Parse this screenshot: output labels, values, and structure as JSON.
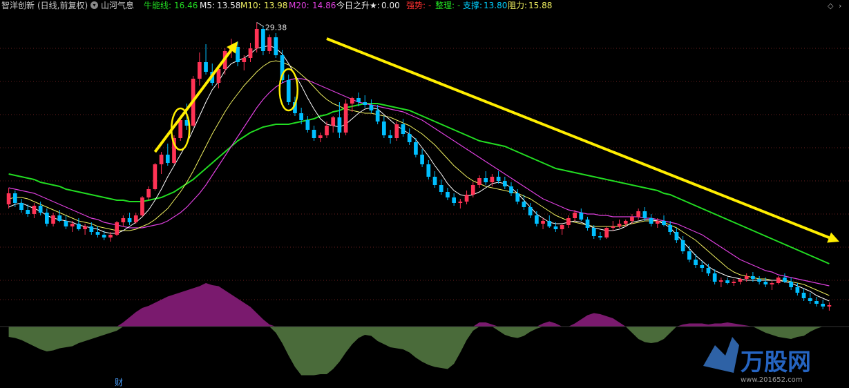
{
  "header": {
    "stock_name": "智洋创新",
    "period": "(日线,前复权)",
    "indicator_name": "山河气息",
    "niuneng_label": "牛能线:",
    "niuneng_value": "16.46",
    "m5_label": "M5:",
    "m5_value": "13.58",
    "m10_label": "M10:",
    "m10_value": "13.98",
    "m20_label": "M20:",
    "m20_value": "14.86",
    "jinri_label": "今日之升★:",
    "jinri_value": "0.00",
    "qiangshi_label": "强势:",
    "qiangshi_value": "-",
    "zhengli_label": "整理:",
    "zhengli_value": "-",
    "zhicheng_label": "支撑:",
    "zhicheng_value": "13.80",
    "zuli_label": "阻力:",
    "zuli_value": "15.88"
  },
  "chart_data": {
    "type": "candlestick",
    "high_marker": "29.38",
    "bottom_label": "财",
    "watermark": "万股网",
    "watermark_url": "www.201652.com",
    "colors": {
      "up": "#ff3355",
      "down": "#00bfff",
      "ma_short": "#ffffff",
      "ma_mid": "#f0f060",
      "ma_pink": "#e040e0",
      "ma_long": "#22dd22",
      "osc_pos": "#7a1a6e",
      "osc_neg": "#4a6b3a",
      "annotation": "#ffee00",
      "grid": "#6a1f1f"
    },
    "candles": [
      [
        16.2,
        17.4,
        15.9,
        17.0
      ],
      [
        17.0,
        17.2,
        16.0,
        16.3
      ],
      [
        16.3,
        16.6,
        15.6,
        15.8
      ],
      [
        15.8,
        16.2,
        15.3,
        15.5
      ],
      [
        15.5,
        16.3,
        15.2,
        16.1
      ],
      [
        16.1,
        16.4,
        15.4,
        15.6
      ],
      [
        15.6,
        15.9,
        14.6,
        14.8
      ],
      [
        14.8,
        15.6,
        14.6,
        15.4
      ],
      [
        15.4,
        15.8,
        14.9,
        15.0
      ],
      [
        15.0,
        15.4,
        14.4,
        14.6
      ],
      [
        14.6,
        15.0,
        14.2,
        14.8
      ],
      [
        14.8,
        15.2,
        14.3,
        14.4
      ],
      [
        14.4,
        14.8,
        14.0,
        14.6
      ],
      [
        14.6,
        14.9,
        14.0,
        14.2
      ],
      [
        14.2,
        14.6,
        13.8,
        14.0
      ],
      [
        14.0,
        14.3,
        13.6,
        13.8
      ],
      [
        13.8,
        14.2,
        13.5,
        14.0
      ],
      [
        14.0,
        15.0,
        13.9,
        14.9
      ],
      [
        14.9,
        15.4,
        14.6,
        15.2
      ],
      [
        15.2,
        15.6,
        14.7,
        14.9
      ],
      [
        14.9,
        15.6,
        14.8,
        15.4
      ],
      [
        15.4,
        16.8,
        15.3,
        16.7
      ],
      [
        16.7,
        17.5,
        16.5,
        17.3
      ],
      [
        17.3,
        19.2,
        17.2,
        19.1
      ],
      [
        19.1,
        20.0,
        18.4,
        19.8
      ],
      [
        19.8,
        20.6,
        19.0,
        19.2
      ],
      [
        19.2,
        21.2,
        19.1,
        21.0
      ],
      [
        21.0,
        22.5,
        20.8,
        22.3
      ],
      [
        22.3,
        23.5,
        21.6,
        21.9
      ],
      [
        21.9,
        25.5,
        21.8,
        25.3
      ],
      [
        25.3,
        27.2,
        24.8,
        26.5
      ],
      [
        26.5,
        27.8,
        25.6,
        25.8
      ],
      [
        25.8,
        26.4,
        24.8,
        25.0
      ],
      [
        25.0,
        26.2,
        24.6,
        26.0
      ],
      [
        26.0,
        27.5,
        25.6,
        27.3
      ],
      [
        27.3,
        28.2,
        26.8,
        27.6
      ],
      [
        27.6,
        28.0,
        26.2,
        26.5
      ],
      [
        26.5,
        27.0,
        25.9,
        26.8
      ],
      [
        26.8,
        27.9,
        26.5,
        27.5
      ],
      [
        27.5,
        29.38,
        27.2,
        28.9
      ],
      [
        28.9,
        29.1,
        27.0,
        27.3
      ],
      [
        27.3,
        28.5,
        27.1,
        28.3
      ],
      [
        28.3,
        28.6,
        26.8,
        27.0
      ],
      [
        27.0,
        27.4,
        25.0,
        25.2
      ],
      [
        25.2,
        25.6,
        23.4,
        23.6
      ],
      [
        23.6,
        24.0,
        22.6,
        22.8
      ],
      [
        22.8,
        23.2,
        22.0,
        22.3
      ],
      [
        22.3,
        22.6,
        21.4,
        21.6
      ],
      [
        21.6,
        21.9,
        20.8,
        21.0
      ],
      [
        21.0,
        21.4,
        20.7,
        21.2
      ],
      [
        21.2,
        22.2,
        21.0,
        21.9
      ],
      [
        21.9,
        22.6,
        21.4,
        22.5
      ],
      [
        22.5,
        23.6,
        21.0,
        21.4
      ],
      [
        21.4,
        23.8,
        21.2,
        23.5
      ],
      [
        23.5,
        24.0,
        22.9,
        23.9
      ],
      [
        23.9,
        24.3,
        23.3,
        23.6
      ],
      [
        23.6,
        24.1,
        23.2,
        23.4
      ],
      [
        23.4,
        23.8,
        22.8,
        23.0
      ],
      [
        23.0,
        23.4,
        22.0,
        22.2
      ],
      [
        22.2,
        22.6,
        21.0,
        21.2
      ],
      [
        21.2,
        21.6,
        20.6,
        21.0
      ],
      [
        21.0,
        22.2,
        20.8,
        22.0
      ],
      [
        22.0,
        22.4,
        21.1,
        21.3
      ],
      [
        21.3,
        21.7,
        20.5,
        20.7
      ],
      [
        20.7,
        21.0,
        19.6,
        19.8
      ],
      [
        19.8,
        20.2,
        18.9,
        19.1
      ],
      [
        19.1,
        19.4,
        18.0,
        18.2
      ],
      [
        18.2,
        18.6,
        17.4,
        17.6
      ],
      [
        17.6,
        18.0,
        16.9,
        17.1
      ],
      [
        17.1,
        17.4,
        16.5,
        16.7
      ],
      [
        16.7,
        17.0,
        16.1,
        16.3
      ],
      [
        16.3,
        16.6,
        15.9,
        16.4
      ],
      [
        16.4,
        17.2,
        16.2,
        16.9
      ],
      [
        16.9,
        17.8,
        16.7,
        17.6
      ],
      [
        17.6,
        18.3,
        17.4,
        18.1
      ],
      [
        18.1,
        18.6,
        17.6,
        17.8
      ],
      [
        17.8,
        18.4,
        17.5,
        18.2
      ],
      [
        18.2,
        18.6,
        17.7,
        17.9
      ],
      [
        17.9,
        18.2,
        17.3,
        17.5
      ],
      [
        17.5,
        17.8,
        16.8,
        17.0
      ],
      [
        17.0,
        17.3,
        16.2,
        16.4
      ],
      [
        16.4,
        16.9,
        15.8,
        16.0
      ],
      [
        16.0,
        16.3,
        15.2,
        15.4
      ],
      [
        15.4,
        15.7,
        14.6,
        14.8
      ],
      [
        14.8,
        15.2,
        14.4,
        15.0
      ],
      [
        15.0,
        15.4,
        14.5,
        14.6
      ],
      [
        14.6,
        14.9,
        14.2,
        14.4
      ],
      [
        14.4,
        14.8,
        14.0,
        14.7
      ],
      [
        14.7,
        15.4,
        14.5,
        15.2
      ],
      [
        15.2,
        15.8,
        15.0,
        15.6
      ],
      [
        15.6,
        15.9,
        15.0,
        15.1
      ],
      [
        15.1,
        15.3,
        14.3,
        14.5
      ],
      [
        14.5,
        14.7,
        13.7,
        13.9
      ],
      [
        13.9,
        14.2,
        13.6,
        13.8
      ],
      [
        13.8,
        14.6,
        13.7,
        14.5
      ],
      [
        14.5,
        15.0,
        14.3,
        14.6
      ],
      [
        14.6,
        15.1,
        14.5,
        14.8
      ],
      [
        14.8,
        15.1,
        14.6,
        15.0
      ],
      [
        15.0,
        15.5,
        14.8,
        15.3
      ],
      [
        15.3,
        15.9,
        15.1,
        15.7
      ],
      [
        15.7,
        16.0,
        15.0,
        15.2
      ],
      [
        15.2,
        15.5,
        14.6,
        14.8
      ],
      [
        14.8,
        15.2,
        14.5,
        15.0
      ],
      [
        15.0,
        15.4,
        14.6,
        14.7
      ],
      [
        14.7,
        15.0,
        14.0,
        14.2
      ],
      [
        14.2,
        14.5,
        13.4,
        13.6
      ],
      [
        13.6,
        13.9,
        12.6,
        12.8
      ],
      [
        12.8,
        13.2,
        12.0,
        12.2
      ],
      [
        12.2,
        12.6,
        11.6,
        11.8
      ],
      [
        11.8,
        12.1,
        11.3,
        11.6
      ],
      [
        11.6,
        11.9,
        11.0,
        11.2
      ],
      [
        11.2,
        11.5,
        10.4,
        10.6
      ],
      [
        10.6,
        10.9,
        10.2,
        10.7
      ],
      [
        10.7,
        10.9,
        10.4,
        10.5
      ],
      [
        10.5,
        10.8,
        10.3,
        10.6
      ],
      [
        10.6,
        10.9,
        10.4,
        10.8
      ],
      [
        10.8,
        11.2,
        10.6,
        11.0
      ],
      [
        11.0,
        11.3,
        10.6,
        10.8
      ],
      [
        10.8,
        11.0,
        10.4,
        10.6
      ],
      [
        10.6,
        10.9,
        10.2,
        10.4
      ],
      [
        10.4,
        10.7,
        10.0,
        10.5
      ],
      [
        10.5,
        11.0,
        10.4,
        10.9
      ],
      [
        10.9,
        11.2,
        10.5,
        10.6
      ],
      [
        10.6,
        10.9,
        10.0,
        10.2
      ],
      [
        10.2,
        10.5,
        9.6,
        9.8
      ],
      [
        9.8,
        10.1,
        9.2,
        9.4
      ],
      [
        9.4,
        9.8,
        9.0,
        9.2
      ],
      [
        9.2,
        9.5,
        8.8,
        9.0
      ],
      [
        9.0,
        9.3,
        8.6,
        8.8
      ],
      [
        8.8,
        9.1,
        8.5,
        8.9
      ]
    ],
    "ma_short": [
      16.0,
      16.2,
      16.3,
      16.1,
      15.9,
      15.7,
      15.4,
      15.2,
      15.1,
      15.0,
      14.9,
      14.7,
      14.6,
      14.5,
      14.4,
      14.2,
      14.1,
      14.1,
      14.3,
      14.6,
      14.9,
      15.3,
      15.8,
      16.5,
      17.3,
      18.2,
      19.0,
      19.8,
      20.6,
      21.6,
      22.6,
      23.6,
      24.5,
      25.1,
      25.9,
      26.4,
      26.6,
      26.8,
      27.1,
      27.5,
      27.6,
      27.7,
      27.5,
      27.1,
      26.4,
      25.6,
      24.8,
      23.9,
      23.1,
      22.4,
      22.0,
      21.9,
      21.8,
      22.0,
      22.4,
      22.8,
      23.1,
      23.2,
      23.1,
      22.7,
      22.3,
      21.9,
      21.6,
      21.3,
      20.9,
      20.3,
      19.7,
      19.0,
      18.4,
      17.7,
      17.2,
      16.9,
      16.8,
      16.9,
      17.1,
      17.4,
      17.7,
      17.8,
      17.7,
      17.4,
      17.0,
      16.5,
      16.0,
      15.5,
      15.2,
      14.9,
      14.8,
      14.8,
      14.9,
      15.0,
      14.9,
      14.7,
      14.5,
      14.4,
      14.3,
      14.3,
      14.4,
      14.6,
      14.9,
      15.0,
      15.1,
      15.1,
      15.0,
      14.8,
      14.5,
      14.0,
      13.5,
      13.0,
      12.5,
      12.1,
      11.7,
      11.4,
      11.2,
      11.0,
      10.9,
      10.8,
      10.7,
      10.7,
      10.7,
      10.7,
      10.7,
      10.7,
      10.6,
      10.5,
      10.3,
      10.1,
      9.9,
      9.6,
      9.4,
      9.2
    ],
    "ma_mid": [
      16.6,
      16.7,
      16.7,
      16.6,
      16.4,
      16.2,
      16.0,
      15.8,
      15.6,
      15.4,
      15.2,
      15.0,
      14.9,
      14.8,
      14.6,
      14.5,
      14.4,
      14.3,
      14.3,
      14.3,
      14.4,
      14.6,
      14.8,
      15.1,
      15.5,
      15.9,
      16.5,
      17.1,
      17.8,
      18.6,
      19.5,
      20.4,
      21.3,
      22.1,
      22.9,
      23.6,
      24.2,
      24.8,
      25.3,
      25.8,
      26.2,
      26.5,
      26.6,
      26.5,
      26.3,
      26.0,
      25.6,
      25.2,
      24.7,
      24.2,
      23.8,
      23.5,
      23.3,
      23.1,
      23.0,
      22.9,
      22.8,
      22.8,
      22.7,
      22.6,
      22.5,
      22.3,
      22.1,
      21.9,
      21.6,
      21.3,
      20.9,
      20.5,
      20.0,
      19.5,
      19.0,
      18.6,
      18.2,
      17.9,
      17.7,
      17.5,
      17.4,
      17.3,
      17.2,
      17.1,
      17.0,
      16.8,
      16.6,
      16.3,
      16.0,
      15.7,
      15.4,
      15.2,
      15.0,
      14.9,
      14.8,
      14.7,
      14.6,
      14.6,
      14.6,
      14.6,
      14.6,
      14.7,
      14.8,
      14.9,
      15.0,
      15.0,
      15.0,
      14.9,
      14.7,
      14.5,
      14.2,
      13.9,
      13.6,
      13.2,
      12.8,
      12.4,
      12.0,
      11.6,
      11.3,
      11.1,
      11.0,
      10.9,
      10.8,
      10.8,
      10.7,
      10.7,
      10.7,
      10.6,
      10.5,
      10.4,
      10.2,
      10.0,
      9.8,
      9.6
    ],
    "ma_pink": [
      17.4,
      17.3,
      17.2,
      17.1,
      17.0,
      16.8,
      16.6,
      16.4,
      16.2,
      16.0,
      15.8,
      15.6,
      15.4,
      15.2,
      15.1,
      14.9,
      14.8,
      14.7,
      14.6,
      14.5,
      14.5,
      14.5,
      14.6,
      14.7,
      14.8,
      15.0,
      15.3,
      15.6,
      16.0,
      16.5,
      17.0,
      17.6,
      18.3,
      19.0,
      19.7,
      20.4,
      21.1,
      21.8,
      22.5,
      23.2,
      23.8,
      24.3,
      24.7,
      25.0,
      25.2,
      25.3,
      25.3,
      25.2,
      25.0,
      24.8,
      24.6,
      24.4,
      24.2,
      24.0,
      23.8,
      23.6,
      23.5,
      23.4,
      23.3,
      23.2,
      23.1,
      23.0,
      22.9,
      22.7,
      22.5,
      22.3,
      22.0,
      21.7,
      21.4,
      21.1,
      20.8,
      20.5,
      20.2,
      19.9,
      19.6,
      19.3,
      19.0,
      18.7,
      18.4,
      18.1,
      17.8,
      17.5,
      17.2,
      16.9,
      16.6,
      16.4,
      16.2,
      16.0,
      15.8,
      15.7,
      15.6,
      15.5,
      15.5,
      15.4,
      15.4,
      15.3,
      15.3,
      15.3,
      15.3,
      15.3,
      15.2,
      15.2,
      15.1,
      15.0,
      14.9,
      14.8,
      14.6,
      14.4,
      14.2,
      14.0,
      13.7,
      13.4,
      13.1,
      12.8,
      12.5,
      12.2,
      12.0,
      11.8,
      11.6,
      11.4,
      11.3,
      11.1,
      11.0,
      10.9,
      10.8,
      10.7,
      10.6,
      10.5,
      10.4,
      10.3
    ],
    "ma_long": [
      18.4,
      18.3,
      18.2,
      18.1,
      18.0,
      17.8,
      17.7,
      17.6,
      17.5,
      17.3,
      17.2,
      17.1,
      17.0,
      16.9,
      16.8,
      16.7,
      16.6,
      16.5,
      16.5,
      16.4,
      16.4,
      16.4,
      16.5,
      16.6,
      16.7,
      16.9,
      17.1,
      17.4,
      17.7,
      18.0,
      18.4,
      18.8,
      19.2,
      19.6,
      20.0,
      20.4,
      20.8,
      21.1,
      21.4,
      21.6,
      21.8,
      21.9,
      22.0,
      22.0,
      22.0,
      22.1,
      22.2,
      22.3,
      22.4,
      22.6,
      22.7,
      22.9,
      23.0,
      23.2,
      23.3,
      23.4,
      23.5,
      23.5,
      23.5,
      23.4,
      23.3,
      23.2,
      23.1,
      23.0,
      22.8,
      22.6,
      22.4,
      22.2,
      22.0,
      21.8,
      21.6,
      21.4,
      21.2,
      21.0,
      20.8,
      20.7,
      20.6,
      20.5,
      20.4,
      20.2,
      20.0,
      19.8,
      19.6,
      19.4,
      19.2,
      19.0,
      18.8,
      18.7,
      18.6,
      18.5,
      18.4,
      18.3,
      18.2,
      18.1,
      18.0,
      17.9,
      17.8,
      17.7,
      17.6,
      17.5,
      17.4,
      17.3,
      17.2,
      17.0,
      16.9,
      16.7,
      16.5,
      16.3,
      16.1,
      15.9,
      15.7,
      15.5,
      15.3,
      15.1,
      14.9,
      14.7,
      14.5,
      14.3,
      14.1,
      13.9,
      13.7,
      13.5,
      13.3,
      13.1,
      12.9,
      12.7,
      12.5,
      12.3,
      12.1,
      11.9
    ],
    "osc": [
      -1.0,
      -1.1,
      -1.3,
      -1.6,
      -1.9,
      -2.2,
      -2.4,
      -2.3,
      -2.1,
      -2.0,
      -1.9,
      -1.6,
      -1.4,
      -1.2,
      -1.0,
      -0.8,
      -0.6,
      -0.4,
      0.4,
      0.9,
      1.4,
      1.8,
      2.0,
      2.3,
      2.6,
      2.9,
      3.1,
      3.3,
      3.5,
      3.7,
      3.9,
      4.2,
      4.0,
      3.9,
      3.5,
      3.1,
      2.7,
      2.3,
      1.9,
      1.3,
      0.7,
      0.2,
      -0.6,
      -1.6,
      -2.8,
      -3.9,
      -4.7,
      -4.7,
      -4.7,
      -4.6,
      -4.6,
      -4.1,
      -3.4,
      -2.5,
      -1.7,
      -1.1,
      -0.8,
      -0.9,
      -1.4,
      -1.7,
      -2.0,
      -2.1,
      -2.2,
      -2.5,
      -3.0,
      -3.4,
      -3.7,
      -3.9,
      -4.0,
      -4.1,
      -3.6,
      -2.5,
      -1.3,
      -0.4,
      0.4,
      0.4,
      0.2,
      -0.4,
      -0.8,
      -1.0,
      -1.1,
      -0.9,
      -0.5,
      -0.2,
      0.3,
      0.5,
      0.3,
      0.0,
      0.0,
      0.3,
      0.7,
      1.1,
      1.3,
      1.2,
      1.0,
      0.8,
      0.4,
      0.0,
      -0.6,
      -1.2,
      -1.5,
      -1.6,
      -1.5,
      -1.2,
      -0.6,
      0.0,
      0.2,
      0.3,
      0.3,
      0.3,
      0.2,
      0.3,
      0.3,
      0.4,
      0.3,
      0.2,
      0.1,
      0.0,
      -0.3,
      -0.6,
      -0.8,
      -1.0,
      -1.1,
      -1.2,
      -1.0,
      -0.9,
      -0.5,
      -0.2,
      0.0,
      0.0
    ],
    "annotation_arrows": [
      {
        "from_idx": 23,
        "from_price": 20.0,
        "to_idx": 36,
        "to_price": 28.0
      },
      {
        "from_idx": 50,
        "from_price": 28.2,
        "to_idx": 148,
        "to_price": 13.5
      }
    ],
    "annotation_circles": [
      27,
      44
    ],
    "price_range": [
      9.0,
      30.0
    ],
    "osc_range": [
      -5,
      5
    ]
  }
}
